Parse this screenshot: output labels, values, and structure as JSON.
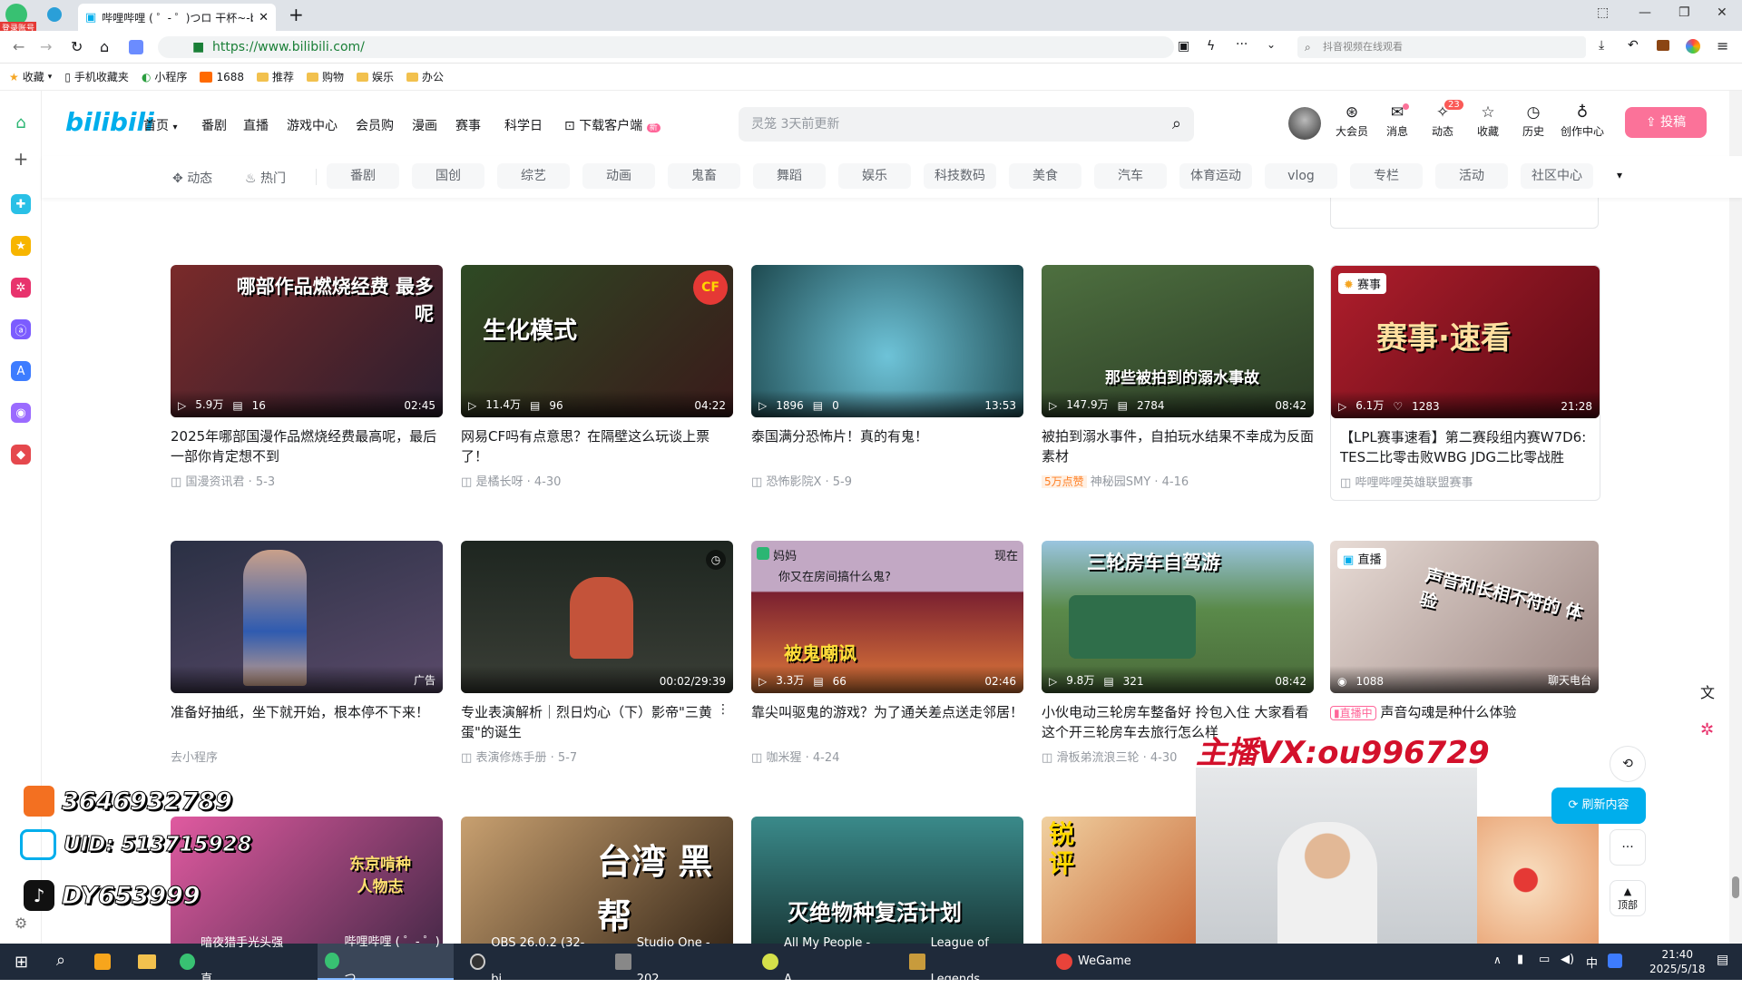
{
  "browser": {
    "badge": "登录账号",
    "tab_title": "哔哩哔哩 ( ゜- ゜)つロ 干杯~-b",
    "new_tab": "+",
    "url": "https://www.bilibili.com/",
    "search_placeholder": "抖音视频在线观看",
    "bookmarks": [
      "收藏",
      "手机收藏夹",
      "小程序",
      "1688",
      "推荐",
      "购物",
      "娱乐",
      "办公"
    ]
  },
  "header": {
    "logo": "bilibili",
    "nav": [
      "首页",
      "番剧",
      "直播",
      "游戏中心",
      "会员购",
      "漫画",
      "赛事",
      "科学日",
      "下载客户端"
    ],
    "nav_new": "新",
    "search_placeholder": "灵笼 3天前更新",
    "icons": [
      {
        "label": "大会员",
        "glyph": "⊛"
      },
      {
        "label": "消息",
        "glyph": "✉"
      },
      {
        "label": "动态",
        "glyph": "✧",
        "badge": "23"
      },
      {
        "label": "收藏",
        "glyph": "☆"
      },
      {
        "label": "历史",
        "glyph": "◷"
      },
      {
        "label": "创作中心",
        "glyph": "♁"
      }
    ],
    "upload": "投稿"
  },
  "categories": {
    "left": [
      "动态",
      "热门"
    ],
    "items": [
      "番剧",
      "国创",
      "综艺",
      "动画",
      "鬼畜",
      "舞蹈",
      "娱乐",
      "科技数码",
      "美食",
      "汽车",
      "体育运动",
      "vlog",
      "专栏",
      "活动",
      "社区中心"
    ]
  },
  "cards": [
    {
      "title": "2025年哪部国漫作品燃烧经费最高呢，最后一部你肯定想不到",
      "views": "5.9万",
      "danmaku": "16",
      "duration": "02:45",
      "author": "国漫资讯君",
      "date": "5-3",
      "overlay": "哪部作品燃烧经费 最多呢",
      "bg": "#6a3a3a"
    },
    {
      "title": "网易CF吗有点意思？在隔壁这么玩谈上票了！",
      "views": "11.4万",
      "danmaku": "96",
      "duration": "04:22",
      "author": "是橘长呀",
      "date": "4-30",
      "overlay": "生化模式",
      "bg": "#3a4a2a"
    },
    {
      "title": "泰国满分恐怖片！真的有鬼！",
      "views": "1896",
      "danmaku": "0",
      "duration": "13:53",
      "author": "恐怖影院X",
      "date": "5-9",
      "overlay": "",
      "bg": "#2e6a6a"
    },
    {
      "title": "被拍到溺水事件，自拍玩水结果不幸成为反面素材",
      "views": "147.9万",
      "danmaku": "2784",
      "duration": "08:42",
      "author": "神秘园SMY",
      "date": "4-16",
      "badge": "5万点赞",
      "overlay": "那些被拍到的溺水事故",
      "bg": "#3a5a3a"
    },
    {
      "title": "【LPL赛事速看】第二赛段组内赛W7D6: TES二比零击败WBG JDG二比零战胜BLG",
      "views": "6.1万",
      "likes": "1283",
      "duration": "21:28",
      "author": "哔哩哔哩英雄联盟赛事",
      "date": "",
      "tag": "赛事",
      "overlay": "赛事·速看",
      "bg": "#8a1a24"
    },
    {
      "title": "准备好抽纸，坐下就开始，根本停不下来！",
      "views": "",
      "danmaku": "",
      "duration": "广告",
      "author": "去小程序",
      "date": "",
      "overlay": "",
      "bg": "#3a3a4a"
    },
    {
      "title": "专业表演解析｜烈日灼心（下）影帝\"三黄蛋\"的诞生",
      "views": "",
      "danmaku": "",
      "duration": "00:02/29:39",
      "author": "表演修炼手册",
      "date": "5-7",
      "overlay": "",
      "bg": "#2a2e2a"
    },
    {
      "title": "靠尖叫驱鬼的游戏？为了通关差点送走邻居！",
      "views": "3.3万",
      "danmaku": "66",
      "duration": "02:46",
      "author": "咖米猩",
      "date": "4-24",
      "overlay": "被鬼嘲讽",
      "bg": "#7a3a4a",
      "msg_name": "妈妈",
      "msg_text": "你又在房间搞什么鬼?",
      "msg_time": "现在"
    },
    {
      "title": "小伙电动三轮房车整备好 拎包入住 大家看看这个开三轮房车去旅行怎么样",
      "views": "9.8万",
      "danmaku": "321",
      "duration": "08:42",
      "author": "滑板弟流浪三轮",
      "date": "4-30",
      "overlay": "三轮房车自驾游",
      "bg": "#4a6a3a"
    },
    {
      "title": "声音勾魂是种什么体验",
      "views": "1088",
      "danmaku": "",
      "duration": "聊天电台",
      "author": "",
      "date": "",
      "tag": "直播",
      "live": "直播中",
      "overlay": "声音和长相不符的 体验",
      "bg": "#c9b7b0"
    },
    {
      "title": "",
      "overlay": "东京啃种 人物志",
      "bg": "#b04a7a"
    },
    {
      "title": "",
      "overlay": "台湾 黑帮",
      "bg": "#5a4a3a"
    },
    {
      "title": "",
      "overlay": "灭绝物种复活计划",
      "bg": "#2a5a5a"
    },
    {
      "title": "",
      "overlay": "锐评",
      "bg": "#e0a060"
    }
  ],
  "stream_overlay": {
    "qq": "3646932789",
    "uid": "UID: 513715928",
    "douyin": "DY653999",
    "vx": "主播VX:ou996729"
  },
  "right_panel": {
    "refresh": "刷新内容",
    "top": "顶部"
  },
  "taskbar": {
    "tasks": [
      "暗夜猎手光头强直...",
      "哔哩哔哩 ( ゜- ゜)つ...",
      "OBS 26.0.2 (32-bi...",
      "Studio One - 202...",
      "All My People - A...",
      "League of Legends",
      "WeGame"
    ],
    "time": "21:40",
    "date": "2025/5/18",
    "ime": "中"
  },
  "colors": {
    "accent": "#00aeec",
    "pink": "#fb7299",
    "taskbar": "#1f2a3a"
  }
}
